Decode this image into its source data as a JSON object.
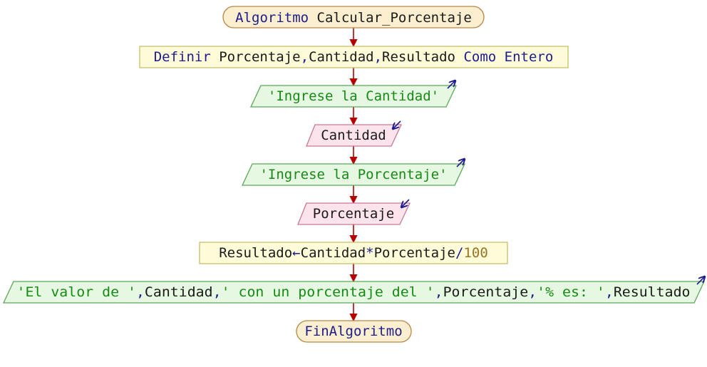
{
  "diagram": {
    "start": {
      "keyword": "Algoritmo",
      "name": "Calcular_Porcentaje"
    },
    "define": {
      "keyword": "Definir",
      "vars": [
        "Porcentaje",
        "Cantidad",
        "Resultado"
      ],
      "sep": ",",
      "as_kw": "Como",
      "type": "Entero"
    },
    "output1": {
      "text": "'Ingrese la Cantidad'"
    },
    "input1": {
      "var": "Cantidad"
    },
    "output2": {
      "text": "'Ingrese la Porcentaje'"
    },
    "input2": {
      "var": "Porcentaje"
    },
    "assign": {
      "target": "Resultado",
      "arrow": "←",
      "a": "Cantidad",
      "mul": "*",
      "b": "Porcentaje",
      "div": "/",
      "num": "100"
    },
    "output3": {
      "s1": "'El valor de '",
      "c1": ",",
      "v1": "Cantidad",
      "c2": ",",
      "s2": "' con un porcentaje del '",
      "c3": ",",
      "v2": "Porcentaje",
      "c4": ",",
      "s3": "'% es: '",
      "c5": ",",
      "v3": "Resultado"
    },
    "end": {
      "keyword": "FinAlgoritmo"
    },
    "colors": {
      "terminal_fill": "#fcefcf",
      "terminal_stroke": "#b8864b",
      "process_fill": "#fdfbd8",
      "process_stroke": "#c9bf6a",
      "output_fill": "#e7f8e2",
      "output_stroke": "#5aa85a",
      "input_fill": "#fde4ec",
      "input_stroke": "#c47a95",
      "arrow": "#b40000",
      "keyword": "#1c1c8c",
      "string": "#168a16",
      "number": "#9a7424"
    },
    "icons": {
      "output": "output-arrow-icon",
      "input": "input-arrow-icon"
    }
  }
}
